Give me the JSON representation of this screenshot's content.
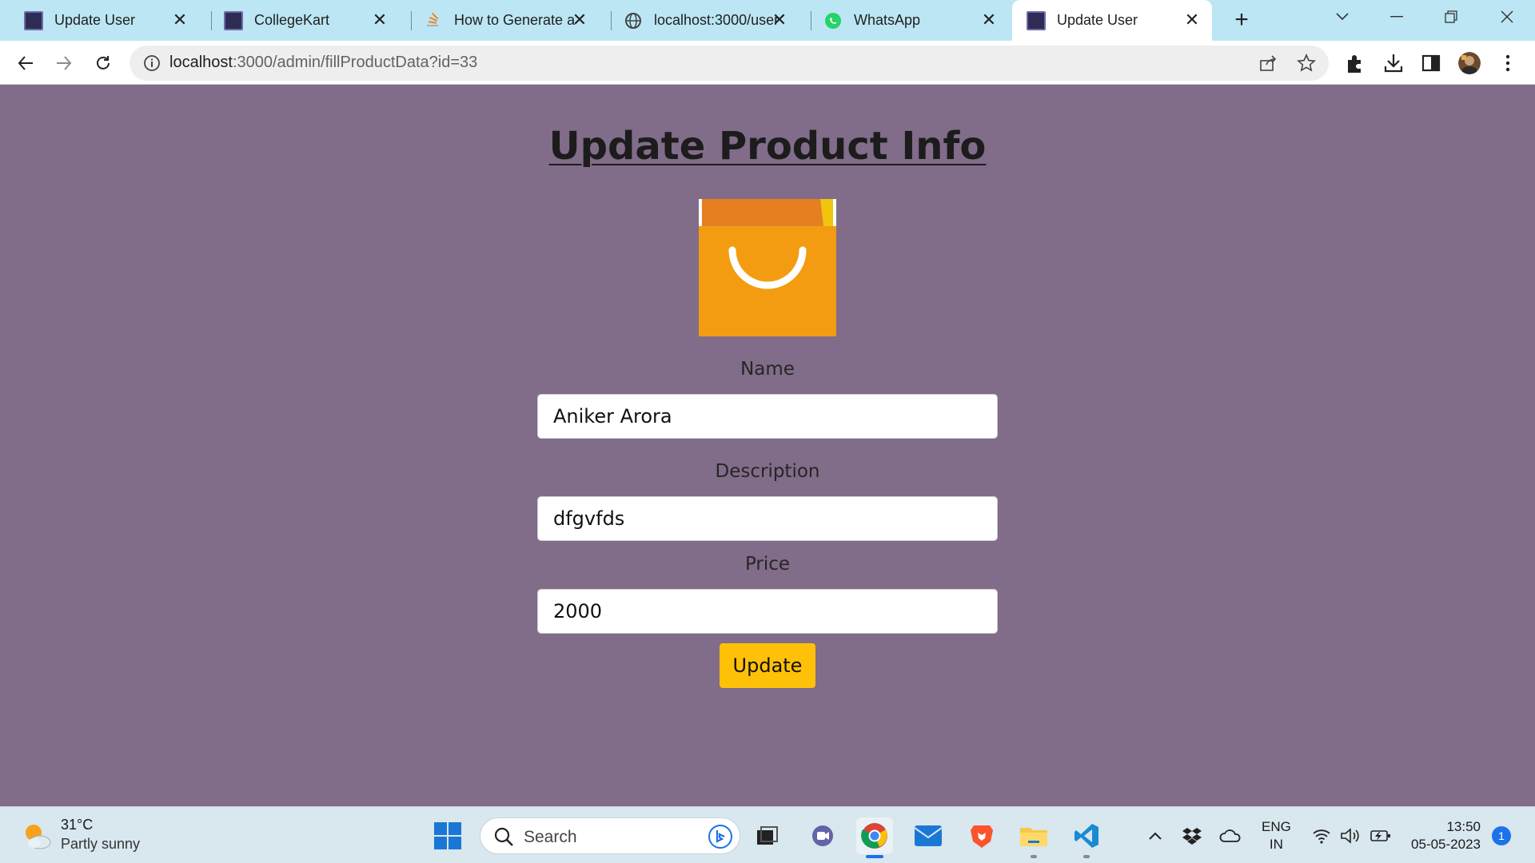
{
  "browser": {
    "tabs": [
      {
        "title": "Update User",
        "icon": "site-favicon",
        "active": false
      },
      {
        "title": "CollegeKart",
        "icon": "site-favicon",
        "active": false
      },
      {
        "title": "How to Generate a",
        "icon": "stackoverflow-favicon",
        "active": false
      },
      {
        "title": "localhost:3000/user",
        "icon": "globe-favicon",
        "active": false
      },
      {
        "title": "WhatsApp",
        "icon": "whatsapp-favicon",
        "active": false
      },
      {
        "title": "Update User",
        "icon": "site-favicon",
        "active": true
      }
    ],
    "url_host": "localhost",
    "url_path": ":3000/admin/fillProductData?id=33"
  },
  "page": {
    "title": "Update Product Info",
    "image_icon": "shopping-bag-icon",
    "image_color": "#f39c12",
    "fields": {
      "name_label": "Name",
      "name_value": "Aniker Arora",
      "description_label": "Description",
      "description_value": "dfgvfds",
      "price_label": "Price",
      "price_value": "2000"
    },
    "update_label": "Update",
    "button_color": "#ffc107",
    "background_color": "#816c89"
  },
  "taskbar": {
    "weather_temp": "31°C",
    "weather_desc": "Partly sunny",
    "search_placeholder": "Search",
    "lang_line1": "ENG",
    "lang_line2": "IN",
    "time": "13:50",
    "date": "05-05-2023",
    "notification_count": "1"
  }
}
